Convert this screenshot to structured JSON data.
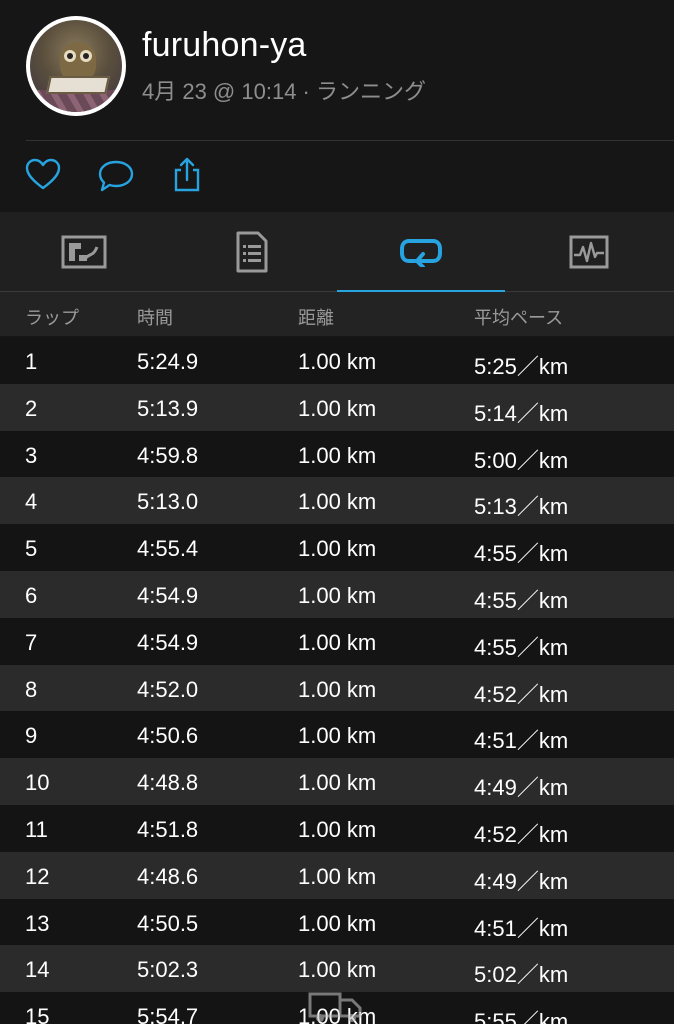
{
  "user": {
    "name": "furuhon-ya",
    "meta": "4月 23 @ 10:14 · ランニング"
  },
  "actions": [
    {
      "icon": "heart-icon"
    },
    {
      "icon": "comment-icon"
    },
    {
      "icon": "share-icon"
    }
  ],
  "tabs": [
    {
      "icon": "map-icon",
      "active": false
    },
    {
      "icon": "details-icon",
      "active": false
    },
    {
      "icon": "laps-icon",
      "active": true
    },
    {
      "icon": "chart-icon",
      "active": false
    }
  ],
  "accent_color": "#27a3e0",
  "table": {
    "headers": [
      "ラップ",
      "時間",
      "距離",
      "平均ペース"
    ],
    "rows": [
      [
        "1",
        "5:24.9",
        "1.00 km",
        "5:25／km"
      ],
      [
        "2",
        "5:13.9",
        "1.00 km",
        "5:14／km"
      ],
      [
        "3",
        "4:59.8",
        "1.00 km",
        "5:00／km"
      ],
      [
        "4",
        "5:13.0",
        "1.00 km",
        "5:13／km"
      ],
      [
        "5",
        "4:55.4",
        "1.00 km",
        "4:55／km"
      ],
      [
        "6",
        "4:54.9",
        "1.00 km",
        "4:55／km"
      ],
      [
        "7",
        "4:54.9",
        "1.00 km",
        "4:55／km"
      ],
      [
        "8",
        "4:52.0",
        "1.00 km",
        "4:52／km"
      ],
      [
        "9",
        "4:50.6",
        "1.00 km",
        "4:51／km"
      ],
      [
        "10",
        "4:48.8",
        "1.00 km",
        "4:49／km"
      ],
      [
        "11",
        "4:51.8",
        "1.00 km",
        "4:52／km"
      ],
      [
        "12",
        "4:48.6",
        "1.00 km",
        "4:49／km"
      ],
      [
        "13",
        "4:50.5",
        "1.00 km",
        "4:51／km"
      ],
      [
        "14",
        "5:02.3",
        "1.00 km",
        "5:02／km"
      ],
      [
        "15",
        "5:54.7",
        "1.00 km",
        "5:55／km"
      ]
    ]
  }
}
